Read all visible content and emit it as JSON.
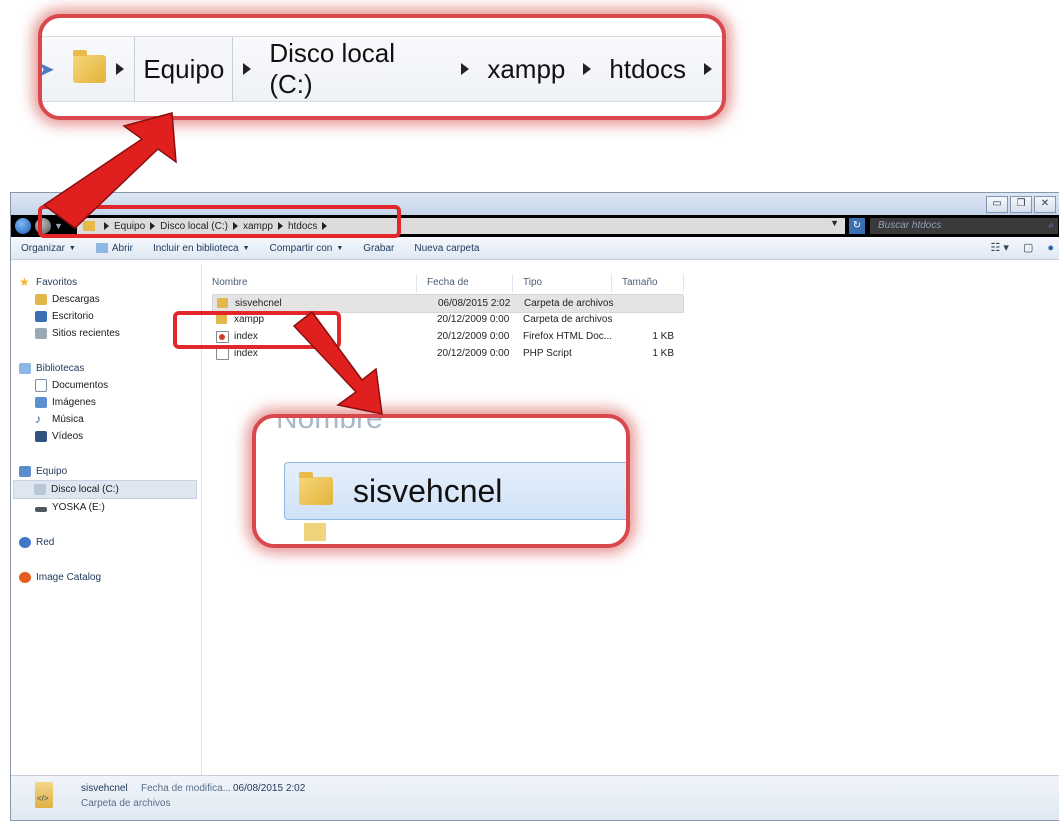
{
  "zoom_breadcrumb": {
    "items": [
      "Equipo",
      "Disco local (C:)",
      "xampp",
      "htdocs"
    ]
  },
  "address_bar": {
    "items": [
      "Equipo",
      "Disco local (C:)",
      "xampp",
      "htdocs"
    ]
  },
  "search": {
    "placeholder": "Buscar htdocs"
  },
  "toolbar": {
    "organize": "Organizar",
    "open": "Abrir",
    "include": "Incluir en biblioteca",
    "share": "Compartir con",
    "burn": "Grabar",
    "new_folder": "Nueva carpeta"
  },
  "sidebar": {
    "favorites": {
      "label": "Favoritos",
      "items": [
        "Descargas",
        "Escritorio",
        "Sitios recientes"
      ]
    },
    "libraries": {
      "label": "Bibliotecas",
      "items": [
        "Documentos",
        "Imágenes",
        "Música",
        "Vídeos"
      ]
    },
    "computer": {
      "label": "Equipo",
      "items": [
        "Disco local (C:)",
        "YOSKA (E:)"
      ]
    },
    "network": "Red",
    "catalog": "Image Catalog"
  },
  "columns": {
    "name": "Nombre",
    "date": "Fecha de modifica...",
    "type": "Tipo",
    "size": "Tamaño"
  },
  "files": [
    {
      "name": "sisvehcnel",
      "date": "06/08/2015 2:02",
      "type": "Carpeta de archivos",
      "size": ""
    },
    {
      "name": "xampp",
      "date": "20/12/2009 0:00",
      "type": "Carpeta de archivos",
      "size": ""
    },
    {
      "name": "index",
      "date": "20/12/2009 0:00",
      "type": "Firefox HTML Doc...",
      "size": "1 KB"
    },
    {
      "name": "index",
      "date": "20/12/2009 0:00",
      "type": "PHP Script",
      "size": "1 KB"
    }
  ],
  "zoom_row": {
    "ghost_header": "Nombre",
    "folder_name": "sisvehcnel"
  },
  "status": {
    "name": "sisvehcnel",
    "date_label": "Fecha de modifica...",
    "date_value": "06/08/2015 2:02",
    "type": "Carpeta de archivos"
  },
  "colors": {
    "highlight": "#e3262a",
    "selection": "#cfe2f7"
  }
}
